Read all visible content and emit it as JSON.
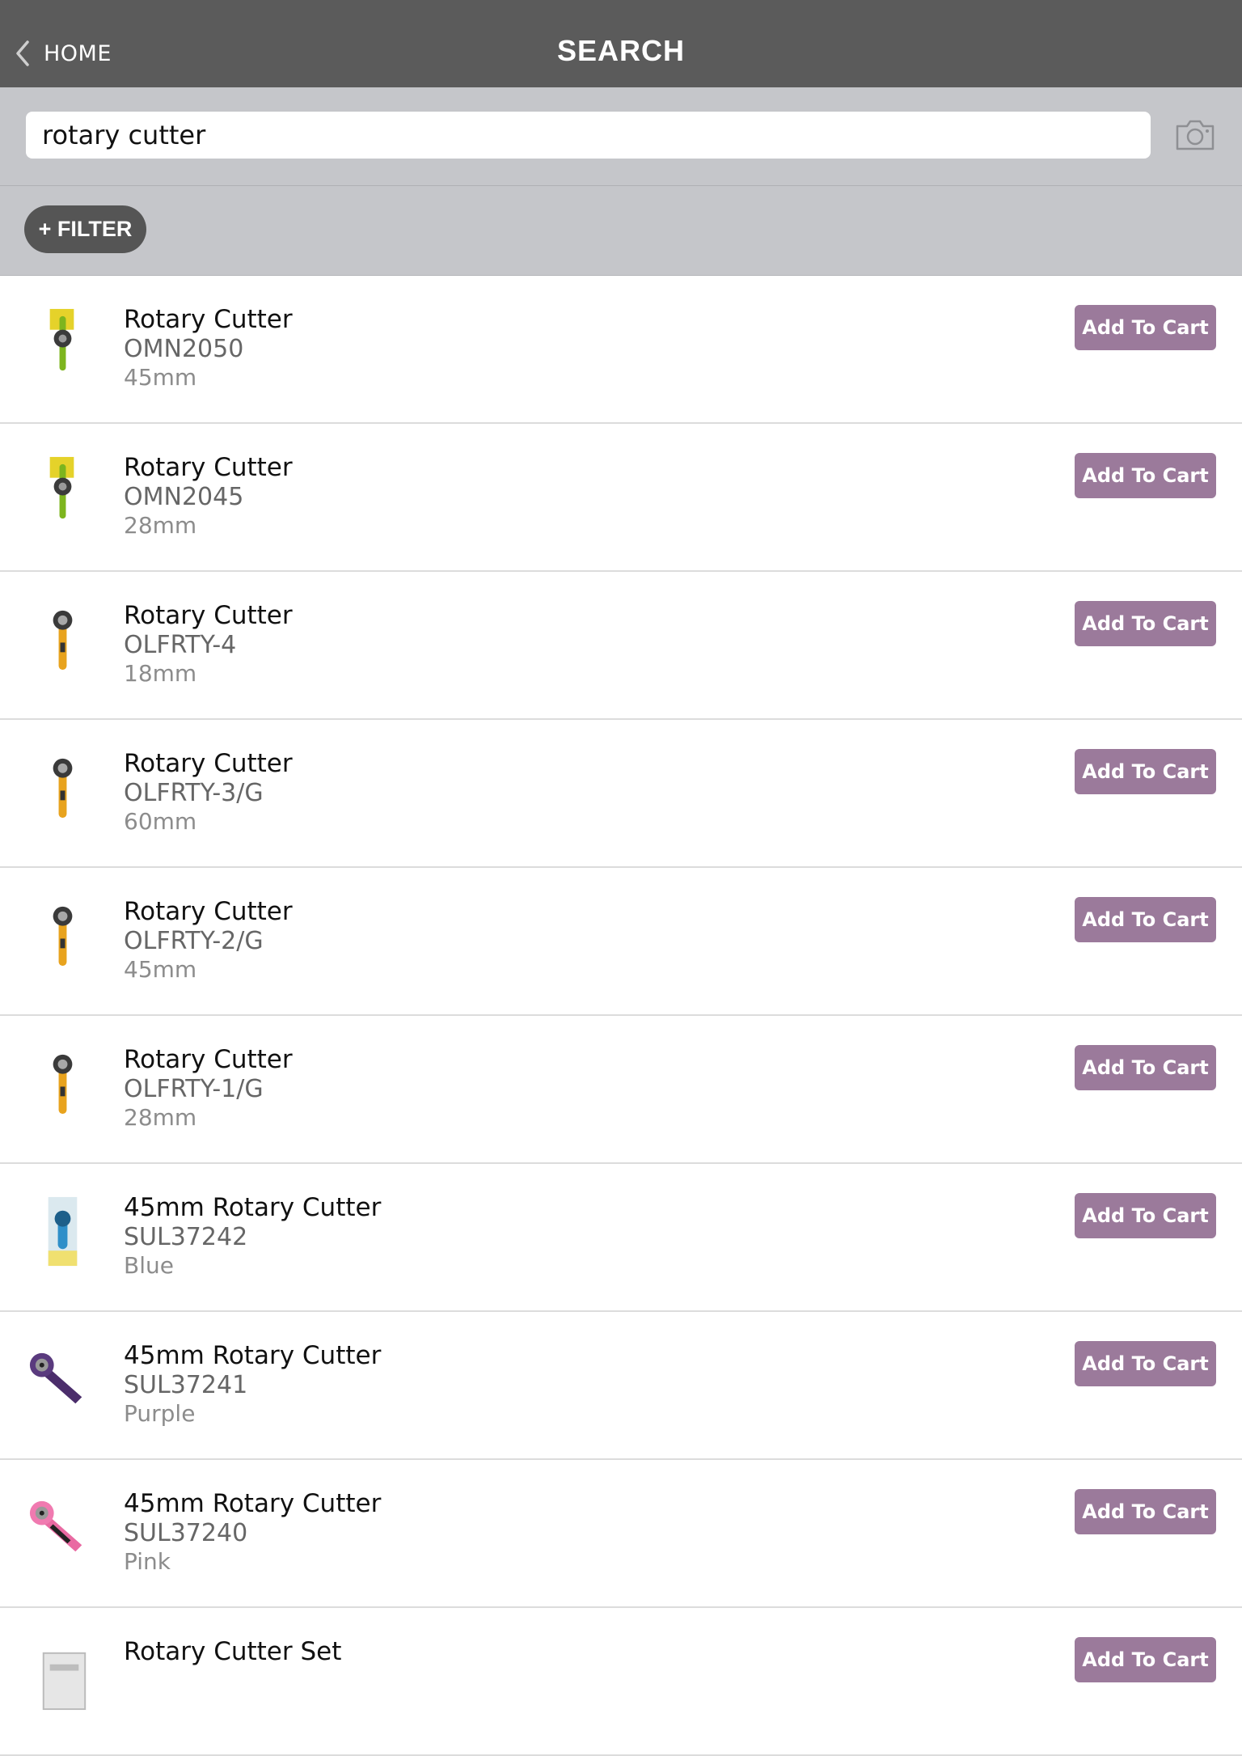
{
  "header": {
    "back_label": "HOME",
    "title": "SEARCH"
  },
  "search": {
    "value": "rotary cutter"
  },
  "filter": {
    "label": "+ FILTER"
  },
  "colors": {
    "accent": "#9b7a9b",
    "header_bg": "#5b5b5b",
    "bar_bg": "#c5c6ca"
  },
  "products": [
    {
      "name": "Rotary Cutter",
      "code": "OMN2050",
      "detail": "45mm",
      "icon": "green-yellow-rotary-cutter-package-icon",
      "cart_label": "Add To Cart"
    },
    {
      "name": "Rotary Cutter",
      "code": "OMN2045",
      "detail": "28mm",
      "icon": "green-yellow-rotary-cutter-package-icon",
      "cart_label": "Add To Cart"
    },
    {
      "name": "Rotary Cutter",
      "code": "OLFRTY-4",
      "detail": "18mm",
      "icon": "yellow-rotary-cutter-icon",
      "cart_label": "Add To Cart"
    },
    {
      "name": "Rotary Cutter",
      "code": "OLFRTY-3/G",
      "detail": "60mm",
      "icon": "yellow-rotary-cutter-icon",
      "cart_label": "Add To Cart"
    },
    {
      "name": "Rotary Cutter",
      "code": "OLFRTY-2/G",
      "detail": "45mm",
      "icon": "yellow-rotary-cutter-icon",
      "cart_label": "Add To Cart"
    },
    {
      "name": "Rotary Cutter",
      "code": "OLFRTY-1/G",
      "detail": "28mm",
      "icon": "yellow-rotary-cutter-icon",
      "cart_label": "Add To Cart"
    },
    {
      "name": "45mm Rotary Cutter",
      "code": "SUL37242",
      "detail": "Blue",
      "icon": "blue-rotary-cutter-package-icon",
      "cart_label": "Add To Cart"
    },
    {
      "name": "45mm Rotary Cutter",
      "code": "SUL37241",
      "detail": "Purple",
      "icon": "purple-rotary-cutter-icon",
      "cart_label": "Add To Cart"
    },
    {
      "name": "45mm Rotary Cutter",
      "code": "SUL37240",
      "detail": "Pink",
      "icon": "pink-rotary-cutter-icon",
      "cart_label": "Add To Cart"
    },
    {
      "name": "Rotary Cutter Set",
      "code": "",
      "detail": "",
      "icon": "rotary-cutter-set-package-icon",
      "cart_label": "Add To Cart"
    }
  ]
}
